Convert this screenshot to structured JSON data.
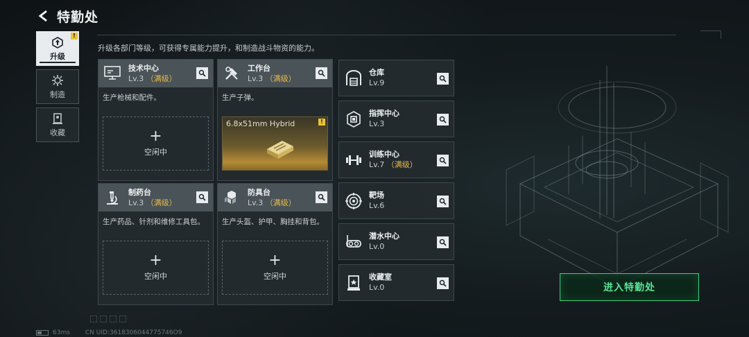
{
  "header": {
    "title": "特勤处",
    "back_icon": "back-arrow-icon"
  },
  "description": "升级各部门等级，可获得专属能力提升，和制造战斗物资的能力。",
  "nav": [
    {
      "label": "升级",
      "icon": "upgrade-icon",
      "active": true,
      "badge": "!"
    },
    {
      "label": "制造",
      "icon": "gear-icon",
      "active": false
    },
    {
      "label": "收藏",
      "icon": "collection-icon",
      "active": false
    }
  ],
  "cards": [
    {
      "name": "技术中心",
      "level": "Lv.3",
      "max_tag": "（满级）",
      "desc": "生产枪械和配件。",
      "icon": "computer-icon",
      "slot": "idle"
    },
    {
      "name": "工作台",
      "level": "Lv.3",
      "max_tag": "（满级）",
      "desc": "生产子弹。",
      "icon": "tools-icon",
      "slot": "producing",
      "product": "6.8x51mm Hybrid",
      "badge": "!"
    },
    {
      "name": "制药台",
      "level": "Lv.3",
      "max_tag": "（满级）",
      "desc": "生产药品、针剂和维修工具包。",
      "icon": "microscope-icon",
      "slot": "idle"
    },
    {
      "name": "防具台",
      "level": "Lv.3",
      "max_tag": "（满级）",
      "desc": "生产头盔、护甲、胸挂和背包。",
      "icon": "armor-blocks-icon",
      "slot": "idle"
    }
  ],
  "idle_slot": {
    "plus": "+",
    "label": "空闲中"
  },
  "list": [
    {
      "name": "仓库",
      "level": "Lv.9",
      "max_tag": "",
      "icon": "warehouse-icon"
    },
    {
      "name": "指挥中心",
      "level": "Lv.3",
      "max_tag": "",
      "icon": "command-chip-icon"
    },
    {
      "name": "训练中心",
      "level": "Lv.7",
      "max_tag": "（满级）",
      "icon": "dumbbell-icon"
    },
    {
      "name": "靶场",
      "level": "Lv.6",
      "max_tag": "",
      "icon": "target-icon"
    },
    {
      "name": "潜水中心",
      "level": "Lv.0",
      "max_tag": "",
      "icon": "diving-mask-icon"
    },
    {
      "name": "收藏室",
      "level": "Lv.0",
      "max_tag": "",
      "icon": "display-case-icon"
    }
  ],
  "enter_button": "进入特勤处",
  "footer": {
    "ping": "63ms",
    "uid": "CN UID:3618306044775746O9"
  },
  "colors": {
    "accent_green": "#3ccf7d",
    "max_gold": "#e6b84a",
    "badge_yellow": "#e8c23a"
  }
}
